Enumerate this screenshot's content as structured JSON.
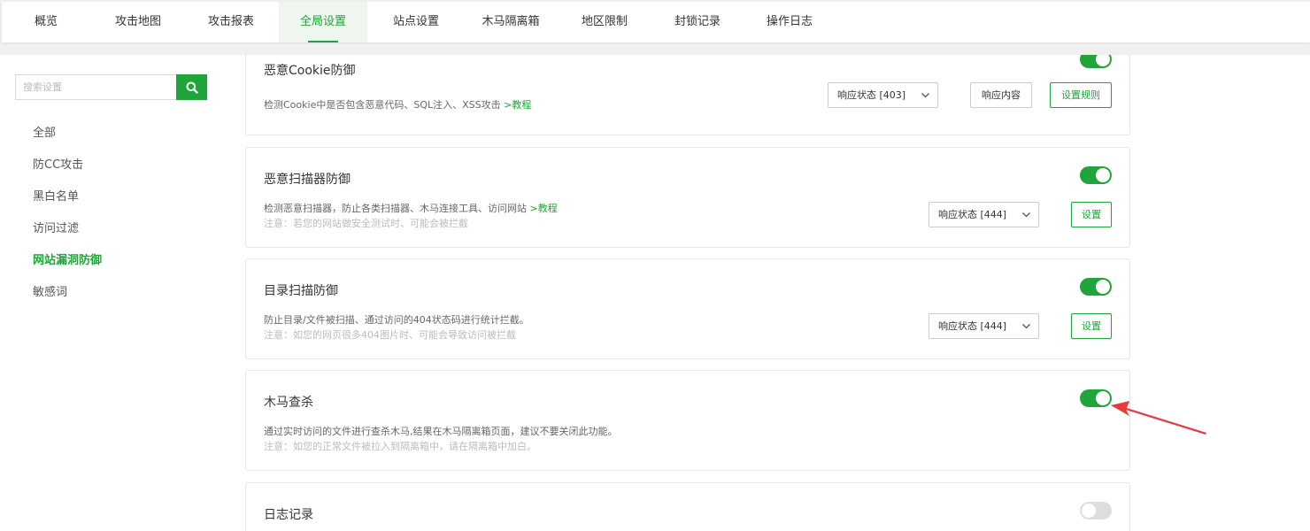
{
  "nav": {
    "tabs": [
      {
        "label": "概览"
      },
      {
        "label": "攻击地图"
      },
      {
        "label": "攻击报表"
      },
      {
        "label": "全局设置"
      },
      {
        "label": "站点设置"
      },
      {
        "label": "木马隔离箱"
      },
      {
        "label": "地区限制"
      },
      {
        "label": "封锁记录"
      },
      {
        "label": "操作日志"
      }
    ],
    "active_tab": "全局设置"
  },
  "sidebar": {
    "search_placeholder": "搜索设置",
    "items": [
      {
        "label": "全部"
      },
      {
        "label": "防CC攻击"
      },
      {
        "label": "黑白名单"
      },
      {
        "label": "访问过滤"
      },
      {
        "label": "网站漏洞防御"
      },
      {
        "label": "敏感词"
      }
    ],
    "active_item": "网站漏洞防御"
  },
  "cards": [
    {
      "title": "恶意Cookie防御",
      "desc": "检测Cookie中是否包含恶意代码、SQL注入、XSS攻击",
      "link": ">教程",
      "enabled": true,
      "select": "响应状态 [403]",
      "btn1": "响应内容",
      "btn2": "设置规则"
    },
    {
      "title": "恶意扫描器防御",
      "desc": "检测恶意扫描器，防止各类扫描器、木马连接工具、访问网站",
      "link": ">教程",
      "note": "注意：若您的网站做安全测试时、可能会被拦截",
      "enabled": true,
      "select": "响应状态 [444]",
      "btn": "设置"
    },
    {
      "title": "目录扫描防御",
      "desc": "防止目录/文件被扫描、通过访问的404状态码进行统计拦截。",
      "note": "注意：如您的网页很多404图片时、可能会导致访问被拦截",
      "enabled": true,
      "select": "响应状态 [444]",
      "btn": "设置"
    },
    {
      "title": "木马查杀",
      "desc": "通过实时访问的文件进行查杀木马,结果在木马隔离箱页面，建议不要关闭此功能。",
      "note": "注意：如您的正常文件被拉入到隔离箱中，请在隔离箱中加白。",
      "enabled": true
    },
    {
      "title": "日志记录",
      "enabled": false
    }
  ],
  "colors": {
    "accent": "#20a53a",
    "annotation_arrow": "#e8393c"
  }
}
